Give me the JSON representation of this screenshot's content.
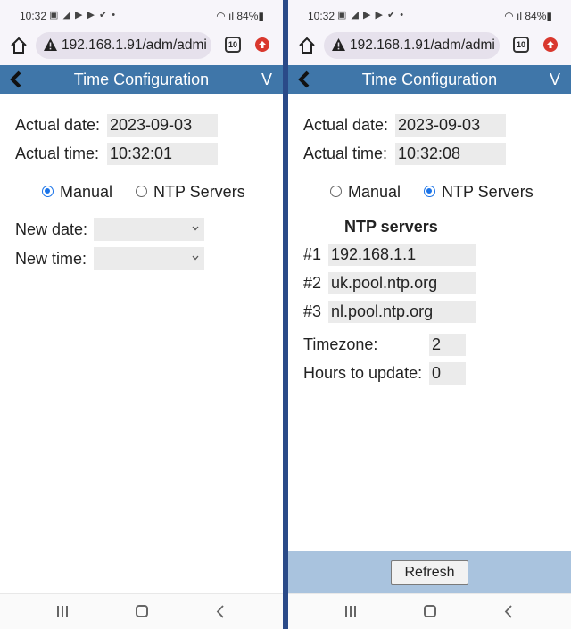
{
  "status": {
    "time": "10:32",
    "battery": "84%"
  },
  "browser": {
    "url": "192.168.1.91/adm/admi",
    "tab_count": "10"
  },
  "app": {
    "title": "Time Configuration",
    "right_label": "V"
  },
  "left": {
    "actual_date_label": "Actual date:",
    "actual_date_value": "2023-09-03",
    "actual_time_label": "Actual time:",
    "actual_time_value": "10:32:01",
    "mode_manual_label": "Manual",
    "mode_ntp_label": "NTP Servers",
    "selected_mode": "manual",
    "new_date_label": "New date:",
    "new_time_label": "New time:"
  },
  "right": {
    "actual_date_label": "Actual date:",
    "actual_date_value": "2023-09-03",
    "actual_time_label": "Actual time:",
    "actual_time_value": "10:32:08",
    "mode_manual_label": "Manual",
    "mode_ntp_label": "NTP Servers",
    "selected_mode": "ntp",
    "ntp_heading": "NTP servers",
    "servers": [
      {
        "index": "#1",
        "value": "192.168.1.1"
      },
      {
        "index": "#2",
        "value": "uk.pool.ntp.org"
      },
      {
        "index": "#3",
        "value": "nl.pool.ntp.org"
      }
    ],
    "timezone_label": "Timezone:",
    "timezone_value": "2",
    "hours_label": "Hours to update:",
    "hours_value": "0",
    "refresh_label": "Refresh"
  },
  "colors": {
    "appbar": "#3f76a9",
    "divider": "#2a4a88",
    "refresh_bar": "#a9c3de",
    "radio_selected": "#1a73e8"
  }
}
